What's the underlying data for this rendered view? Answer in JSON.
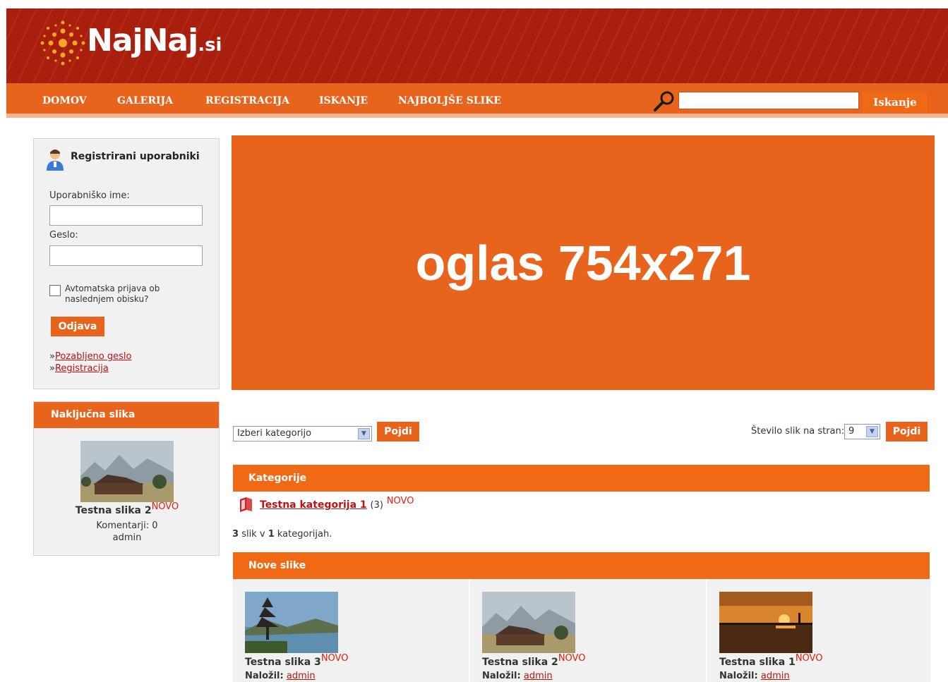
{
  "header": {
    "logo_main": "NajNaj",
    "logo_suffix": ".si",
    "nav": [
      "DOMOV",
      "GALERIJA",
      "REGISTRACIJA",
      "ISKANJE",
      "NAJBOLJŠE SLIKE"
    ],
    "search_button": "Iskanje",
    "search_value": ""
  },
  "login": {
    "title": "Registrirani uporabniki",
    "username_label": "Uporabniško ime:",
    "password_label": "Geslo:",
    "remember_label": "Avtomatska prijava ob naslednjem obisku?",
    "logout_button": "Odjava",
    "link_prefix": "»",
    "forgot_link": "Pozabljeno geslo",
    "register_link": "Registracija"
  },
  "random_image": {
    "header": "Naključna slika",
    "title": "Testna slika 2",
    "badge": "NOVO",
    "comments": "Komentarji: 0",
    "author": "admin"
  },
  "ad": {
    "text": "oglas 754x271"
  },
  "filters": {
    "category_select": "Izberi kategorijo",
    "go_button": "Pojdi",
    "per_page_label": "Število slik na stran:",
    "per_page_value": "9",
    "go_button_2": "Pojdi"
  },
  "categories": {
    "header": "Kategorije",
    "items": [
      {
        "name": "Testna kategorija 1",
        "count": "(3)",
        "badge": "NOVO"
      }
    ],
    "stats_count": "3",
    "stats_mid": "slik v",
    "stats_cats": "1",
    "stats_end": "kategorijah."
  },
  "new_images": {
    "header": "Nove slike",
    "uploaded_label": "Naložil:",
    "items": [
      {
        "title": "Testna slika 3",
        "badge": "NOVO",
        "author": "admin"
      },
      {
        "title": "Testna slika 2",
        "badge": "NOVO",
        "author": "admin"
      },
      {
        "title": "Testna slika 1",
        "badge": "NOVO",
        "author": "admin"
      }
    ]
  },
  "colors": {
    "header_red": "#a81f0e",
    "nav_orange": "#e8641c",
    "accent_orange": "#f06a15",
    "link_red": "#c01212",
    "badge_red": "#e81d0c"
  }
}
